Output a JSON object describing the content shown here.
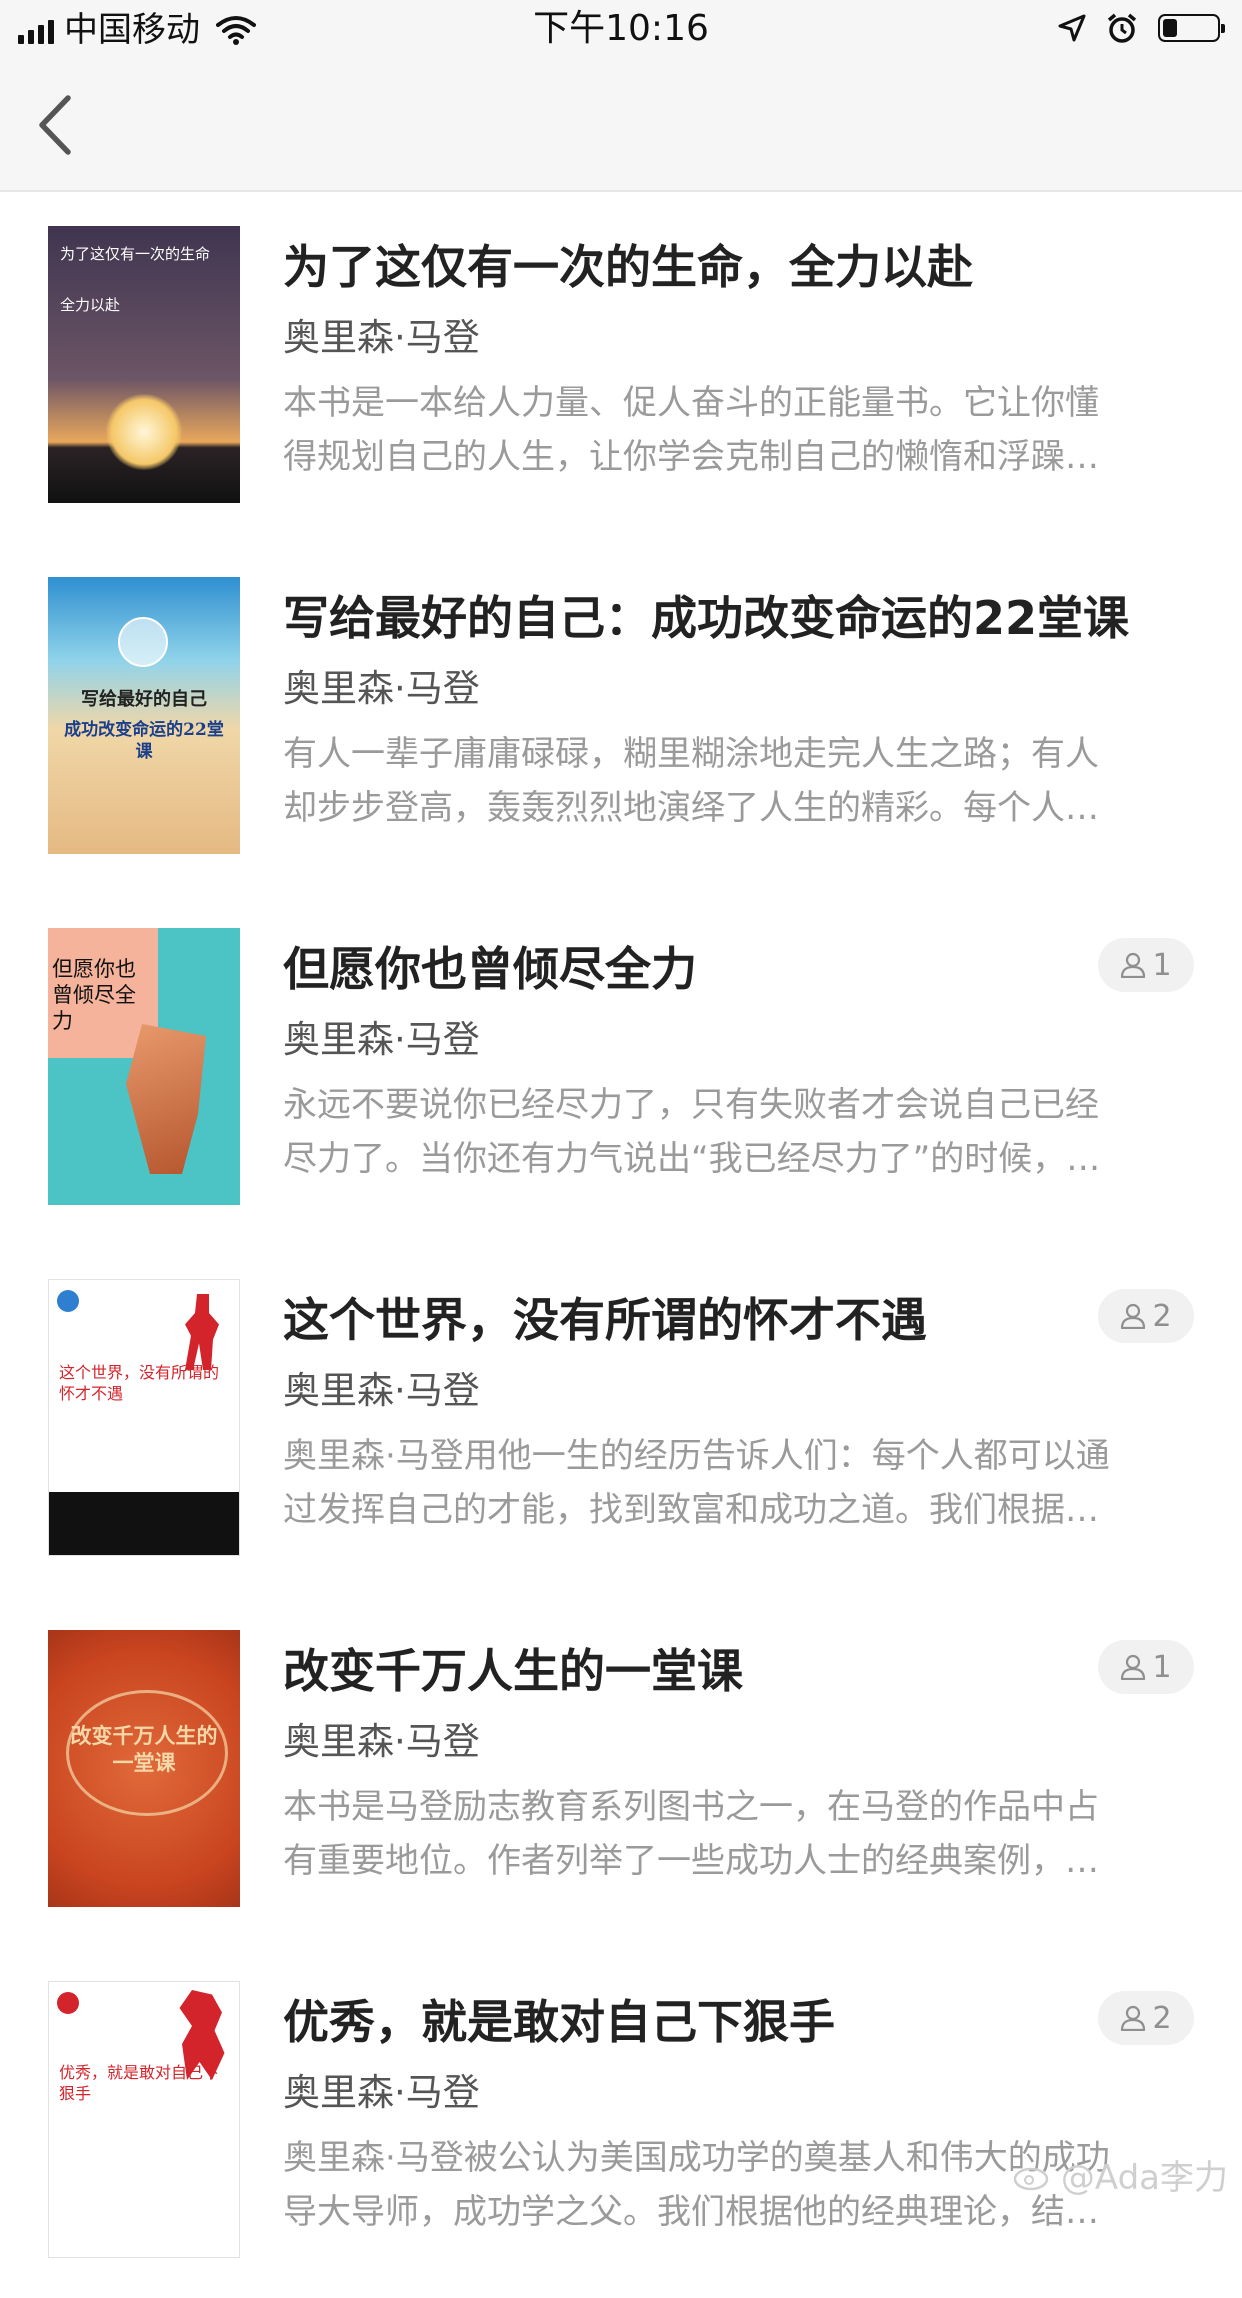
{
  "status_bar": {
    "carrier": "中国移动",
    "time": "下午10:16"
  },
  "nav": {
    "back_icon": "chevron-left-icon"
  },
  "books": [
    {
      "title": "为了这仅有一次的生命，全力以赴",
      "author": "奥里森·马登",
      "desc_line1": "本书是一本给人力量、促人奋斗的正能量书。它让你懂",
      "desc_line2": "得规划自己的人生，让你学会克制自己的懒惰和浮躁…",
      "readers": "",
      "cover": {
        "bg": "#4a3a52",
        "accent": "#f2c14e",
        "text1": "为了这仅有一次的生命",
        "text2": "全力以赴"
      }
    },
    {
      "title": "写给最好的自己：成功改变命运的22堂课",
      "author": "奥里森·马登",
      "desc_line1": "有人一辈子庸庸碌碌，糊里糊涂地走完人生之路；有人",
      "desc_line2": "却步步登高，轰轰烈烈地演绎了人生的精彩。每个人…",
      "readers": "",
      "cover": {
        "bg": "#e9c79a",
        "accent": "#3aa7d8",
        "text1": "写给最好的自己",
        "text2": "成功改变命运的22堂课"
      }
    },
    {
      "title": "但愿你也曾倾尽全力",
      "author": "奥里森·马登",
      "desc_line1": "永远不要说你已经尽力了，只有失败者才会说自己已经",
      "desc_line2": "尽力了。当你还有力气说出“我已经尽力了”的时候，…",
      "readers": "1",
      "cover": {
        "bg": "#4cc3c4",
        "accent": "#f4b39a",
        "text1": "但愿你也曾倾尽全力",
        "text2": ""
      }
    },
    {
      "title": "这个世界，没有所谓的怀才不遇",
      "author": "奥里森·马登",
      "desc_line1": "奥里森·马登用他一生的经历告诉人们：每个人都可以通",
      "desc_line2": "过发挥自己的才能，找到致富和成功之道。我们根据…",
      "readers": "2",
      "cover": {
        "bg": "#ffffff",
        "accent": "#d4242b",
        "text1": "这个世界，没有所谓的怀才不遇",
        "text2": ""
      }
    },
    {
      "title": "改变千万人生的一堂课",
      "author": "奥里森·马登",
      "desc_line1": "本书是马登励志教育系列图书之一，在马登的作品中占",
      "desc_line2": "有重要地位。作者列举了一些成功人士的经典案例，…",
      "readers": "1",
      "cover": {
        "bg": "#d4562a",
        "accent": "#f5d7a8",
        "text1": "改变千万人生的一堂课",
        "text2": ""
      }
    },
    {
      "title": "优秀，就是敢对自己下狠手",
      "author": "奥里森·马登",
      "desc_line1": "奥里森·马登被公认为美国成功学的奠基人和伟大的成功",
      "desc_line2": "导大导师，成功学之父。我们根据他的经典理论，结…",
      "readers": "2",
      "cover": {
        "bg": "#ffffff",
        "accent": "#d4242b",
        "text1": "优秀，就是敢对自己下狠手",
        "text2": ""
      }
    }
  ],
  "watermark": "@Ada李力"
}
